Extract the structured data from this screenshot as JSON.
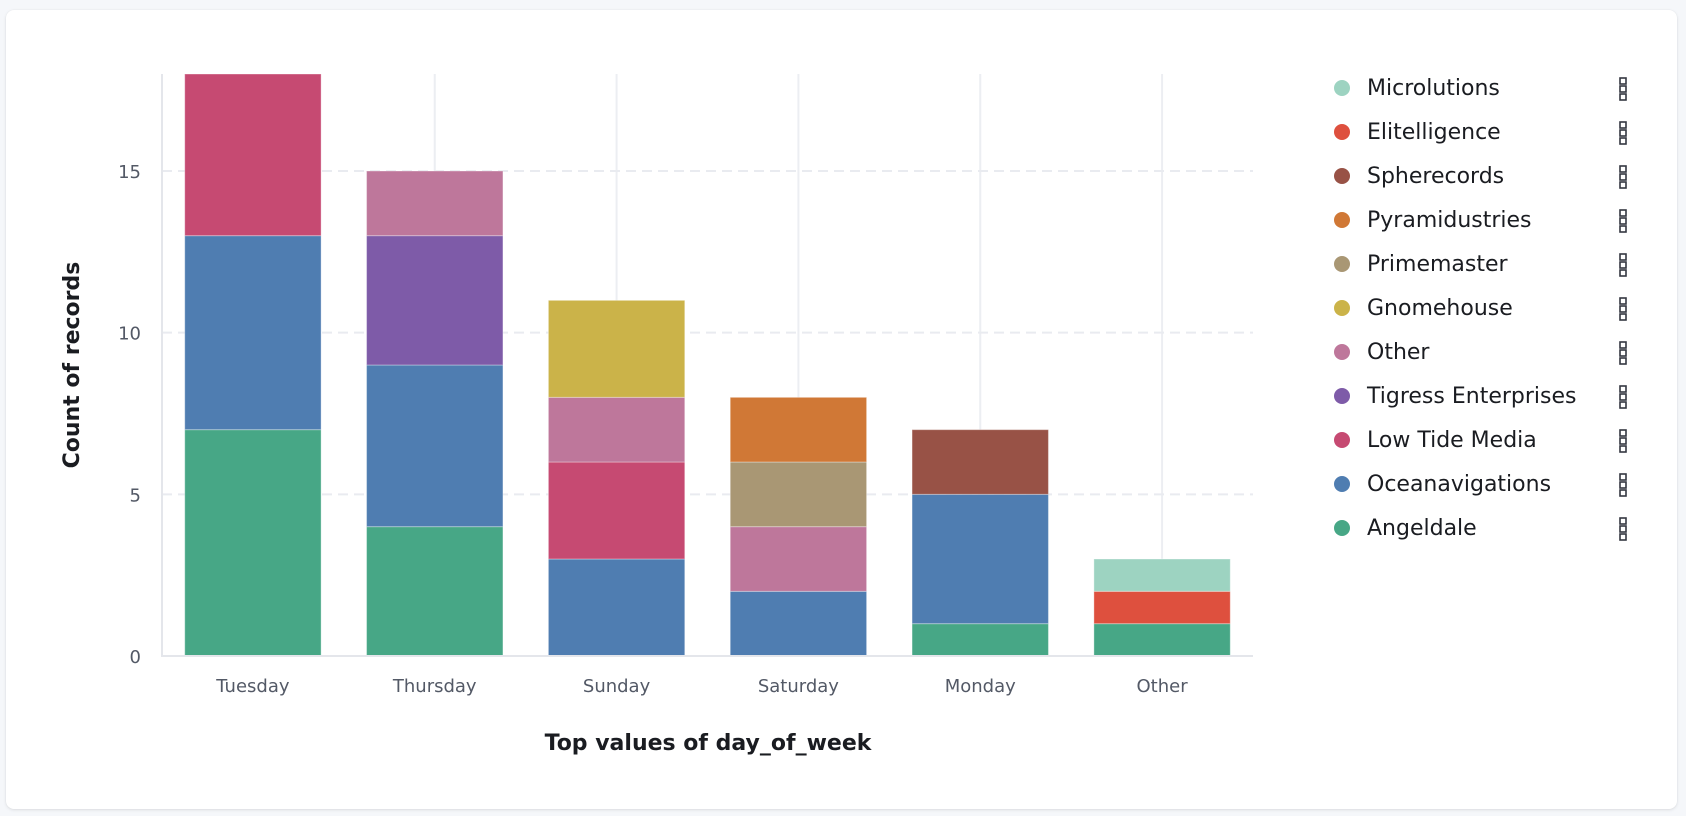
{
  "chart_data": {
    "type": "bar",
    "stacked": true,
    "title": "",
    "xlabel": "Top values of day_of_week",
    "ylabel": "Count of records",
    "categories": [
      "Tuesday",
      "Thursday",
      "Sunday",
      "Saturday",
      "Monday",
      "Other"
    ],
    "ylim": [
      0,
      18
    ],
    "yticks": [
      0,
      5,
      10,
      15
    ],
    "grid": true,
    "legend_position": "right",
    "series": [
      {
        "name": "Angeldale",
        "color": "#47a786",
        "values": [
          7,
          4,
          0,
          0,
          1,
          1
        ]
      },
      {
        "name": "Oceanavigations",
        "color": "#4f7db1",
        "values": [
          6,
          5,
          3,
          2,
          4,
          0
        ]
      },
      {
        "name": "Low Tide Media",
        "color": "#c64a72",
        "values": [
          5,
          0,
          3,
          0,
          0,
          0
        ]
      },
      {
        "name": "Tigress Enterprises",
        "color": "#7e5ba8",
        "values": [
          0,
          4,
          0,
          0,
          0,
          0
        ]
      },
      {
        "name": "Other",
        "color": "#be779b",
        "values": [
          0,
          2,
          2,
          2,
          0,
          0
        ]
      },
      {
        "name": "Gnomehouse",
        "color": "#cbb349",
        "values": [
          0,
          0,
          3,
          0,
          0,
          0
        ]
      },
      {
        "name": "Primemaster",
        "color": "#a99774",
        "values": [
          0,
          0,
          0,
          2,
          0,
          0
        ]
      },
      {
        "name": "Pyramidustries",
        "color": "#d07836",
        "values": [
          0,
          0,
          0,
          2,
          0,
          0
        ]
      },
      {
        "name": "Spherecords",
        "color": "#985246",
        "values": [
          0,
          0,
          0,
          0,
          2,
          0
        ]
      },
      {
        "name": "Elitelligence",
        "color": "#de503e",
        "values": [
          0,
          0,
          0,
          0,
          0,
          1
        ]
      },
      {
        "name": "Microlutions",
        "color": "#9dd3c1",
        "values": [
          0,
          0,
          0,
          0,
          0,
          1
        ]
      }
    ]
  },
  "legend": {
    "items": [
      {
        "label": "Microlutions",
        "color": "#9dd3c1",
        "action_icon": "boxes-vertical-icon"
      },
      {
        "label": "Elitelligence",
        "color": "#de503e",
        "action_icon": "boxes-vertical-icon"
      },
      {
        "label": "Spherecords",
        "color": "#985246",
        "action_icon": "boxes-vertical-icon"
      },
      {
        "label": "Pyramidustries",
        "color": "#d07836",
        "action_icon": "boxes-vertical-icon"
      },
      {
        "label": "Primemaster",
        "color": "#a99774",
        "action_icon": "boxes-vertical-icon"
      },
      {
        "label": "Gnomehouse",
        "color": "#cbb349",
        "action_icon": "boxes-vertical-icon"
      },
      {
        "label": "Other",
        "color": "#be779b",
        "action_icon": "boxes-vertical-icon"
      },
      {
        "label": "Tigress Enterprises",
        "color": "#7e5ba8",
        "action_icon": "boxes-vertical-icon"
      },
      {
        "label": "Low Tide Media",
        "color": "#c64a72",
        "action_icon": "boxes-vertical-icon"
      },
      {
        "label": "Oceanavigations",
        "color": "#4f7db1",
        "action_icon": "boxes-vertical-icon"
      },
      {
        "label": "Angeldale",
        "color": "#47a786",
        "action_icon": "boxes-vertical-icon"
      }
    ]
  }
}
